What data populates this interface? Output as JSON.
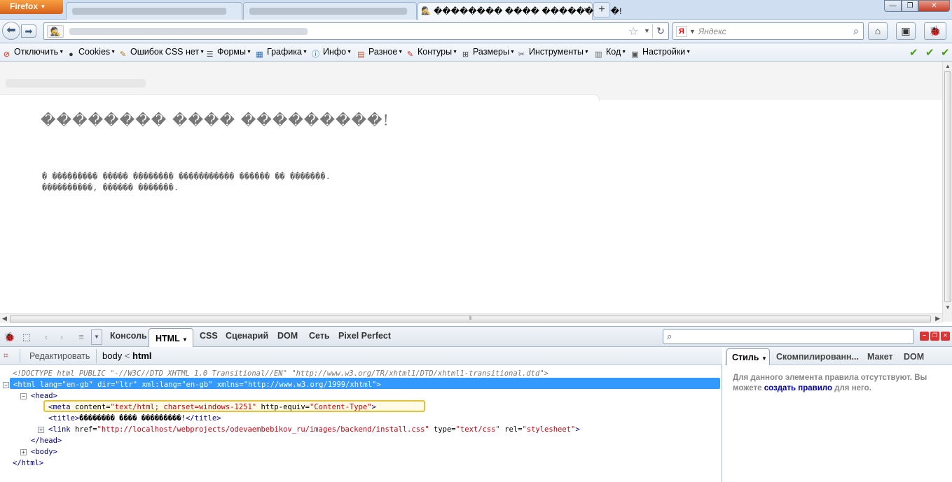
{
  "browser": {
    "menu_label": "Firefox",
    "tab_active_title": "�������� ���� ���������!",
    "tab_close": "×",
    "new_tab": "+"
  },
  "window_controls": {
    "minimize": "—",
    "maximize": "❐",
    "close": "✕"
  },
  "nav": {
    "search_placeholder": "Яндекс",
    "search_engine": "Я"
  },
  "webdev_toolbar": {
    "items": [
      {
        "label": "Отключить",
        "icon": "disable-icon",
        "color": "#cc2a1a"
      },
      {
        "label": "Cookies",
        "icon": "cookie-person-icon",
        "color": "#333333"
      },
      {
        "label": "Ошибок CSS нет",
        "icon": "pencil-icon",
        "color": "#b07b20"
      },
      {
        "label": "Формы",
        "icon": "form-icon",
        "color": "#555555"
      },
      {
        "label": "Графика",
        "icon": "image-icon",
        "color": "#2a6ab0"
      },
      {
        "label": "Инфо",
        "icon": "info-icon",
        "color": "#1f5fc4"
      },
      {
        "label": "Разное",
        "icon": "misc-icon",
        "color": "#c05020"
      },
      {
        "label": "Контуры",
        "icon": "outline-pencil-icon",
        "color": "#c0302a"
      },
      {
        "label": "Размеры",
        "icon": "resize-icon",
        "color": "#444444"
      },
      {
        "label": "Инструменты",
        "icon": "tools-icon",
        "color": "#555555"
      },
      {
        "label": "Код",
        "icon": "source-icon",
        "color": "#666666"
      },
      {
        "label": "Настройки",
        "icon": "settings-icon",
        "color": "#555555"
      }
    ]
  },
  "page": {
    "heading": "�������� ���� ���������!",
    "paragraph_line1": "� ��������� ����� �������� ����������� ������ �� �������.",
    "paragraph_line2": "����������, ������ �������."
  },
  "firebug": {
    "tabs": [
      "Консоль",
      "HTML",
      "CSS",
      "Сценарий",
      "DOM",
      "Сеть",
      "Pixel Perfect"
    ],
    "active_tab": "HTML",
    "edit_label": "Редактировать",
    "breadcrumb_body": "body",
    "breadcrumb_sep": "<",
    "breadcrumb_html": "html",
    "code": {
      "doctype": "<!DOCTYPE html PUBLIC \"-//W3C//DTD XHTML 1.0 Transitional//EN\" \"http://www.w3.org/TR/xhtml1/DTD/xhtml1-transitional.dtd\">",
      "html_open": "<html lang=\"en-gb\" dir=\"ltr\" xml:lang=\"en-gb\" xmlns=\"http://www.w3.org/1999/xhtml\">",
      "head_open": "<head>",
      "meta_tag": "<meta",
      "meta_attr1_name": "content=",
      "meta_attr1_val": "\"text/html; charset=windows-1251\"",
      "meta_attr2_name": "http-equiv=",
      "meta_attr2_val": "\"Content-Type\"",
      "meta_close": ">",
      "title_open": "<title>",
      "title_text": "�������� ���� ���������!",
      "title_close": "</title>",
      "link_tag": "<link",
      "link_href_name": "href=",
      "link_href_val": "\"http://localhost/webprojects/odevaembebikov_ru/images/backend/install.css\"",
      "link_type_name": "type=",
      "link_type_val": "\"text/css\"",
      "link_rel_name": "rel=",
      "link_rel_val": "\"stylesheet\"",
      "link_close": ">",
      "head_close": "</head>",
      "body_open": "<body>",
      "html_close": "</html>"
    },
    "side_tabs": [
      "Стиль",
      "Скомпилированн...",
      "Макет",
      "DOM"
    ],
    "side_active": "Стиль",
    "side_msg_before": "Для данного элемента правила отсутствуют. Вы можете",
    "side_msg_link": "создать правило",
    "side_msg_after": "для него."
  }
}
